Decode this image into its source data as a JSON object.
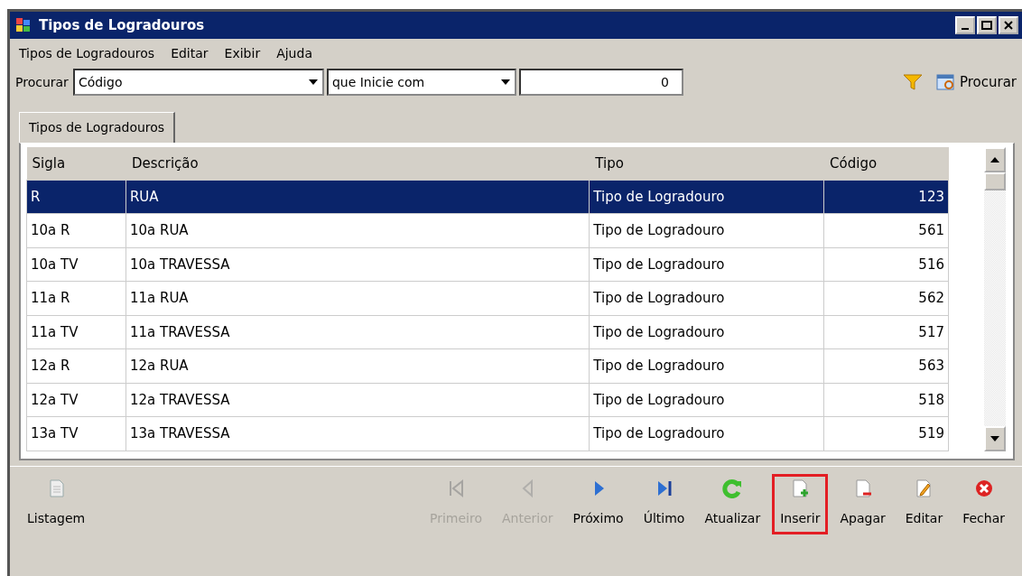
{
  "window": {
    "title": "Tipos de Logradouros"
  },
  "menu": [
    "Tipos de Logradouros",
    "Editar",
    "Exibir",
    "Ajuda"
  ],
  "search": {
    "label": "Procurar",
    "field": "Código",
    "operator": "que Inicie com",
    "value": "0",
    "button": "Procurar"
  },
  "tabs": [
    {
      "label": "Tipos de Logradouros",
      "selected": true
    }
  ],
  "table": {
    "columns": [
      "Sigla",
      "Descrição",
      "Tipo",
      "Código"
    ],
    "rows": [
      {
        "cells": [
          "R",
          "RUA",
          "Tipo de Logradouro",
          "123"
        ],
        "selected": true
      },
      {
        "cells": [
          "10a R",
          "10a RUA",
          "Tipo de Logradouro",
          "561"
        ],
        "selected": false
      },
      {
        "cells": [
          "10a TV",
          "10a TRAVESSA",
          "Tipo de Logradouro",
          "516"
        ],
        "selected": false
      },
      {
        "cells": [
          "11a R",
          "11a RUA",
          "Tipo de Logradouro",
          "562"
        ],
        "selected": false
      },
      {
        "cells": [
          "11a TV",
          "11a TRAVESSA",
          "Tipo de Logradouro",
          "517"
        ],
        "selected": false
      },
      {
        "cells": [
          "12a R",
          "12a RUA",
          "Tipo de Logradouro",
          "563"
        ],
        "selected": false
      },
      {
        "cells": [
          "12a TV",
          "12a TRAVESSA",
          "Tipo de Logradouro",
          "518"
        ],
        "selected": false
      },
      {
        "cells": [
          "13a TV",
          "13a TRAVESSA",
          "Tipo de Logradouro",
          "519"
        ],
        "selected": false
      }
    ]
  },
  "toolbar": [
    {
      "kind": "list",
      "label": "Listagem",
      "disabled": false,
      "highlighted": false
    },
    {
      "kind": "first",
      "label": "Primeiro",
      "disabled": true,
      "highlighted": false
    },
    {
      "kind": "prev",
      "label": "Anterior",
      "disabled": true,
      "highlighted": false
    },
    {
      "kind": "next",
      "label": "Próximo",
      "disabled": false,
      "highlighted": false
    },
    {
      "kind": "last",
      "label": "Último",
      "disabled": false,
      "highlighted": false
    },
    {
      "kind": "refresh",
      "label": "Atualizar",
      "disabled": false,
      "highlighted": false
    },
    {
      "kind": "insert",
      "label": "Inserir",
      "disabled": false,
      "highlighted": true
    },
    {
      "kind": "delete",
      "label": "Apagar",
      "disabled": false,
      "highlighted": false
    },
    {
      "kind": "edit",
      "label": "Editar",
      "disabled": false,
      "highlighted": false
    },
    {
      "kind": "close",
      "label": "Fechar",
      "disabled": false,
      "highlighted": false
    }
  ]
}
